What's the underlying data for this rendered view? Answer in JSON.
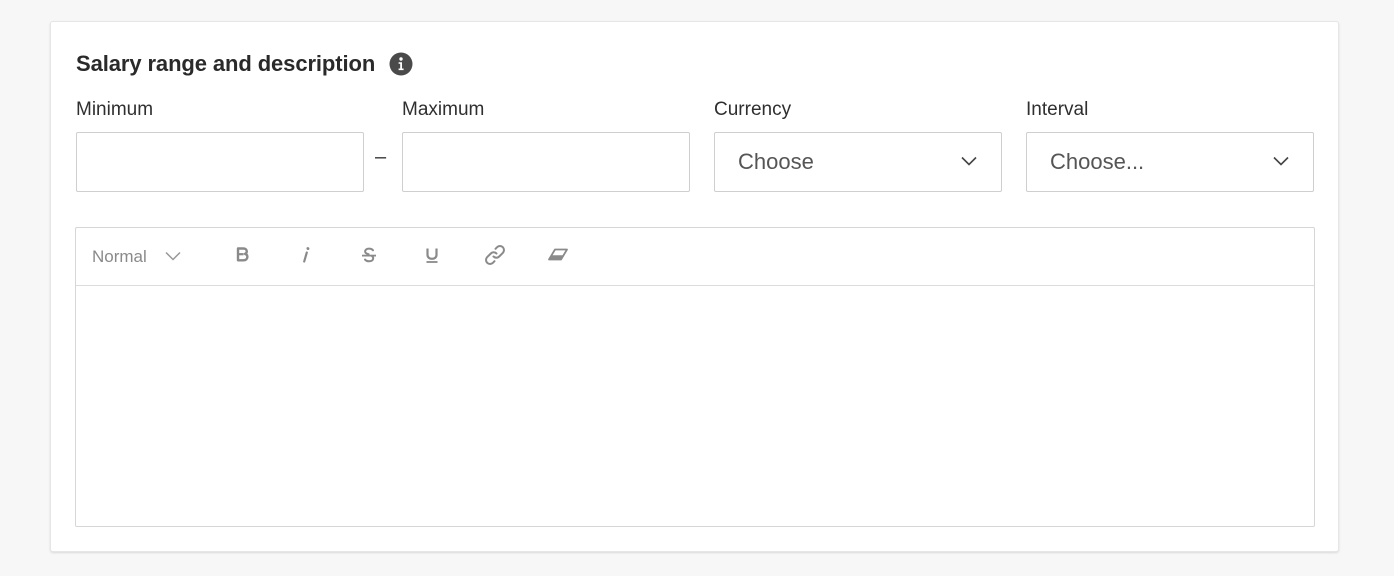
{
  "section": {
    "title": "Salary range and description",
    "info_icon": "info-icon"
  },
  "fields": {
    "minimum": {
      "label": "Minimum",
      "value": "",
      "placeholder": ""
    },
    "separator": "–",
    "maximum": {
      "label": "Maximum",
      "value": "",
      "placeholder": ""
    },
    "currency": {
      "label": "Currency",
      "selected": "Choose"
    },
    "interval": {
      "label": "Interval",
      "selected": "Choose..."
    }
  },
  "editor": {
    "toolbar": {
      "style_selected": "Normal",
      "buttons": [
        "bold-icon",
        "italic-icon",
        "strikethrough-icon",
        "underline-icon",
        "link-icon",
        "clear-format-icon"
      ]
    },
    "content": ""
  },
  "colors": {
    "background": "#f7f7f7",
    "card": "#ffffff",
    "border": "#cfcfcf",
    "icon": "#8a8a8a",
    "title": "#2a2a2a"
  }
}
